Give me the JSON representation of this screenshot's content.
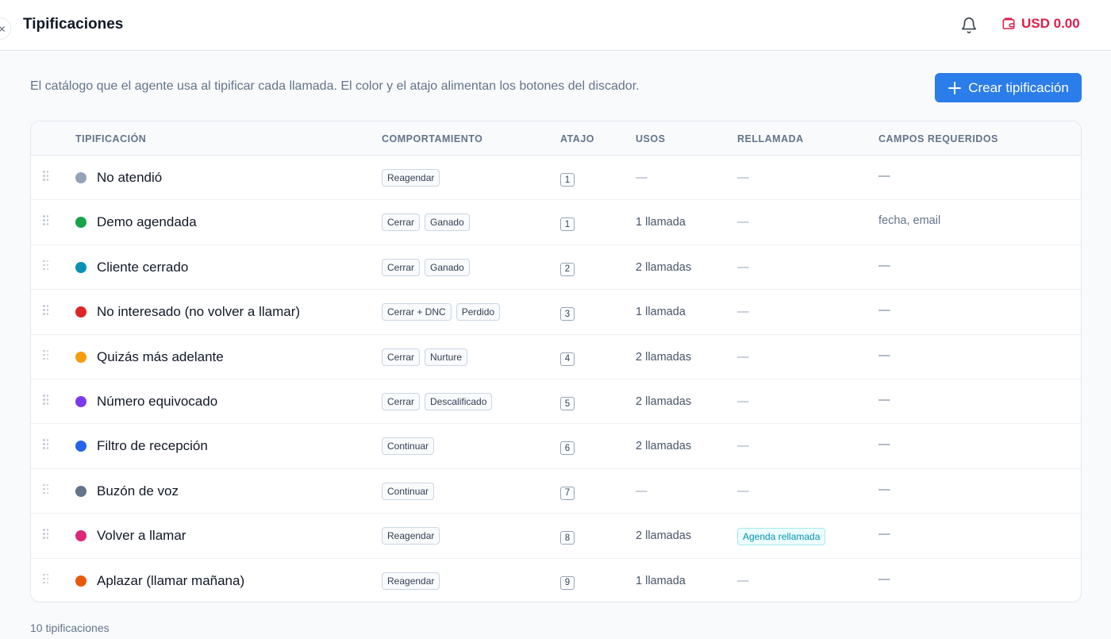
{
  "header": {
    "title": "Tipificaciones",
    "balance": "USD 0.00"
  },
  "colors": {
    "accent": "#2b7de9",
    "balance": "#e11d48"
  },
  "page": {
    "description": "El catálogo que el agente usa al tipificar cada llamada. El color y el atajo alimentan los botones del discador.",
    "create_button": "Crear tipificación",
    "count_label": "10 tipificaciones"
  },
  "table": {
    "headers": {
      "name": "TIPIFICACIÓN",
      "behavior": "COMPORTAMIENTO",
      "shortcut": "ATAJO",
      "uses": "USOS",
      "callback": "RELLAMADA",
      "fields": "CAMPOS REQUERIDOS"
    },
    "rows": [
      {
        "name": "No atendió",
        "color": "#94a3b8",
        "tags": [
          "Reagendar"
        ],
        "shortcut": "1",
        "uses": "—",
        "callback": "—",
        "fields": "—"
      },
      {
        "name": "Demo agendada",
        "color": "#16a34a",
        "tags": [
          "Cerrar",
          "Ganado"
        ],
        "shortcut": "1",
        "uses": "1 llamada",
        "callback": "—",
        "fields": "fecha, email"
      },
      {
        "name": "Cliente cerrado",
        "color": "#0891b2",
        "tags": [
          "Cerrar",
          "Ganado"
        ],
        "shortcut": "2",
        "uses": "2 llamadas",
        "callback": "—",
        "fields": "—"
      },
      {
        "name": "No interesado (no volver a llamar)",
        "color": "#dc2626",
        "tags": [
          "Cerrar + DNC",
          "Perdido"
        ],
        "shortcut": "3",
        "uses": "1 llamada",
        "callback": "—",
        "fields": "—"
      },
      {
        "name": "Quizás más adelante",
        "color": "#f59e0b",
        "tags": [
          "Cerrar",
          "Nurture"
        ],
        "shortcut": "4",
        "uses": "2 llamadas",
        "callback": "—",
        "fields": "—"
      },
      {
        "name": "Número equivocado",
        "color": "#7c3aed",
        "tags": [
          "Cerrar",
          "Descalificado"
        ],
        "shortcut": "5",
        "uses": "2 llamadas",
        "callback": "—",
        "fields": "—"
      },
      {
        "name": "Filtro de recepción",
        "color": "#2563eb",
        "tags": [
          "Continuar"
        ],
        "shortcut": "6",
        "uses": "2 llamadas",
        "callback": "—",
        "fields": "—"
      },
      {
        "name": "Buzón de voz",
        "color": "#64748b",
        "tags": [
          "Continuar"
        ],
        "shortcut": "7",
        "uses": "—",
        "callback": "—",
        "fields": "—"
      },
      {
        "name": "Volver a llamar",
        "color": "#db2777",
        "tags": [
          "Reagendar"
        ],
        "shortcut": "8",
        "uses": "2 llamadas",
        "callback": "Agenda rellamada",
        "callback_is_tag": true,
        "fields": "—"
      },
      {
        "name": "Aplazar (llamar mañana)",
        "color": "#ea580c",
        "tags": [
          "Reagendar"
        ],
        "shortcut": "9",
        "uses": "1 llamada",
        "callback": "—",
        "fields": "—"
      }
    ]
  }
}
